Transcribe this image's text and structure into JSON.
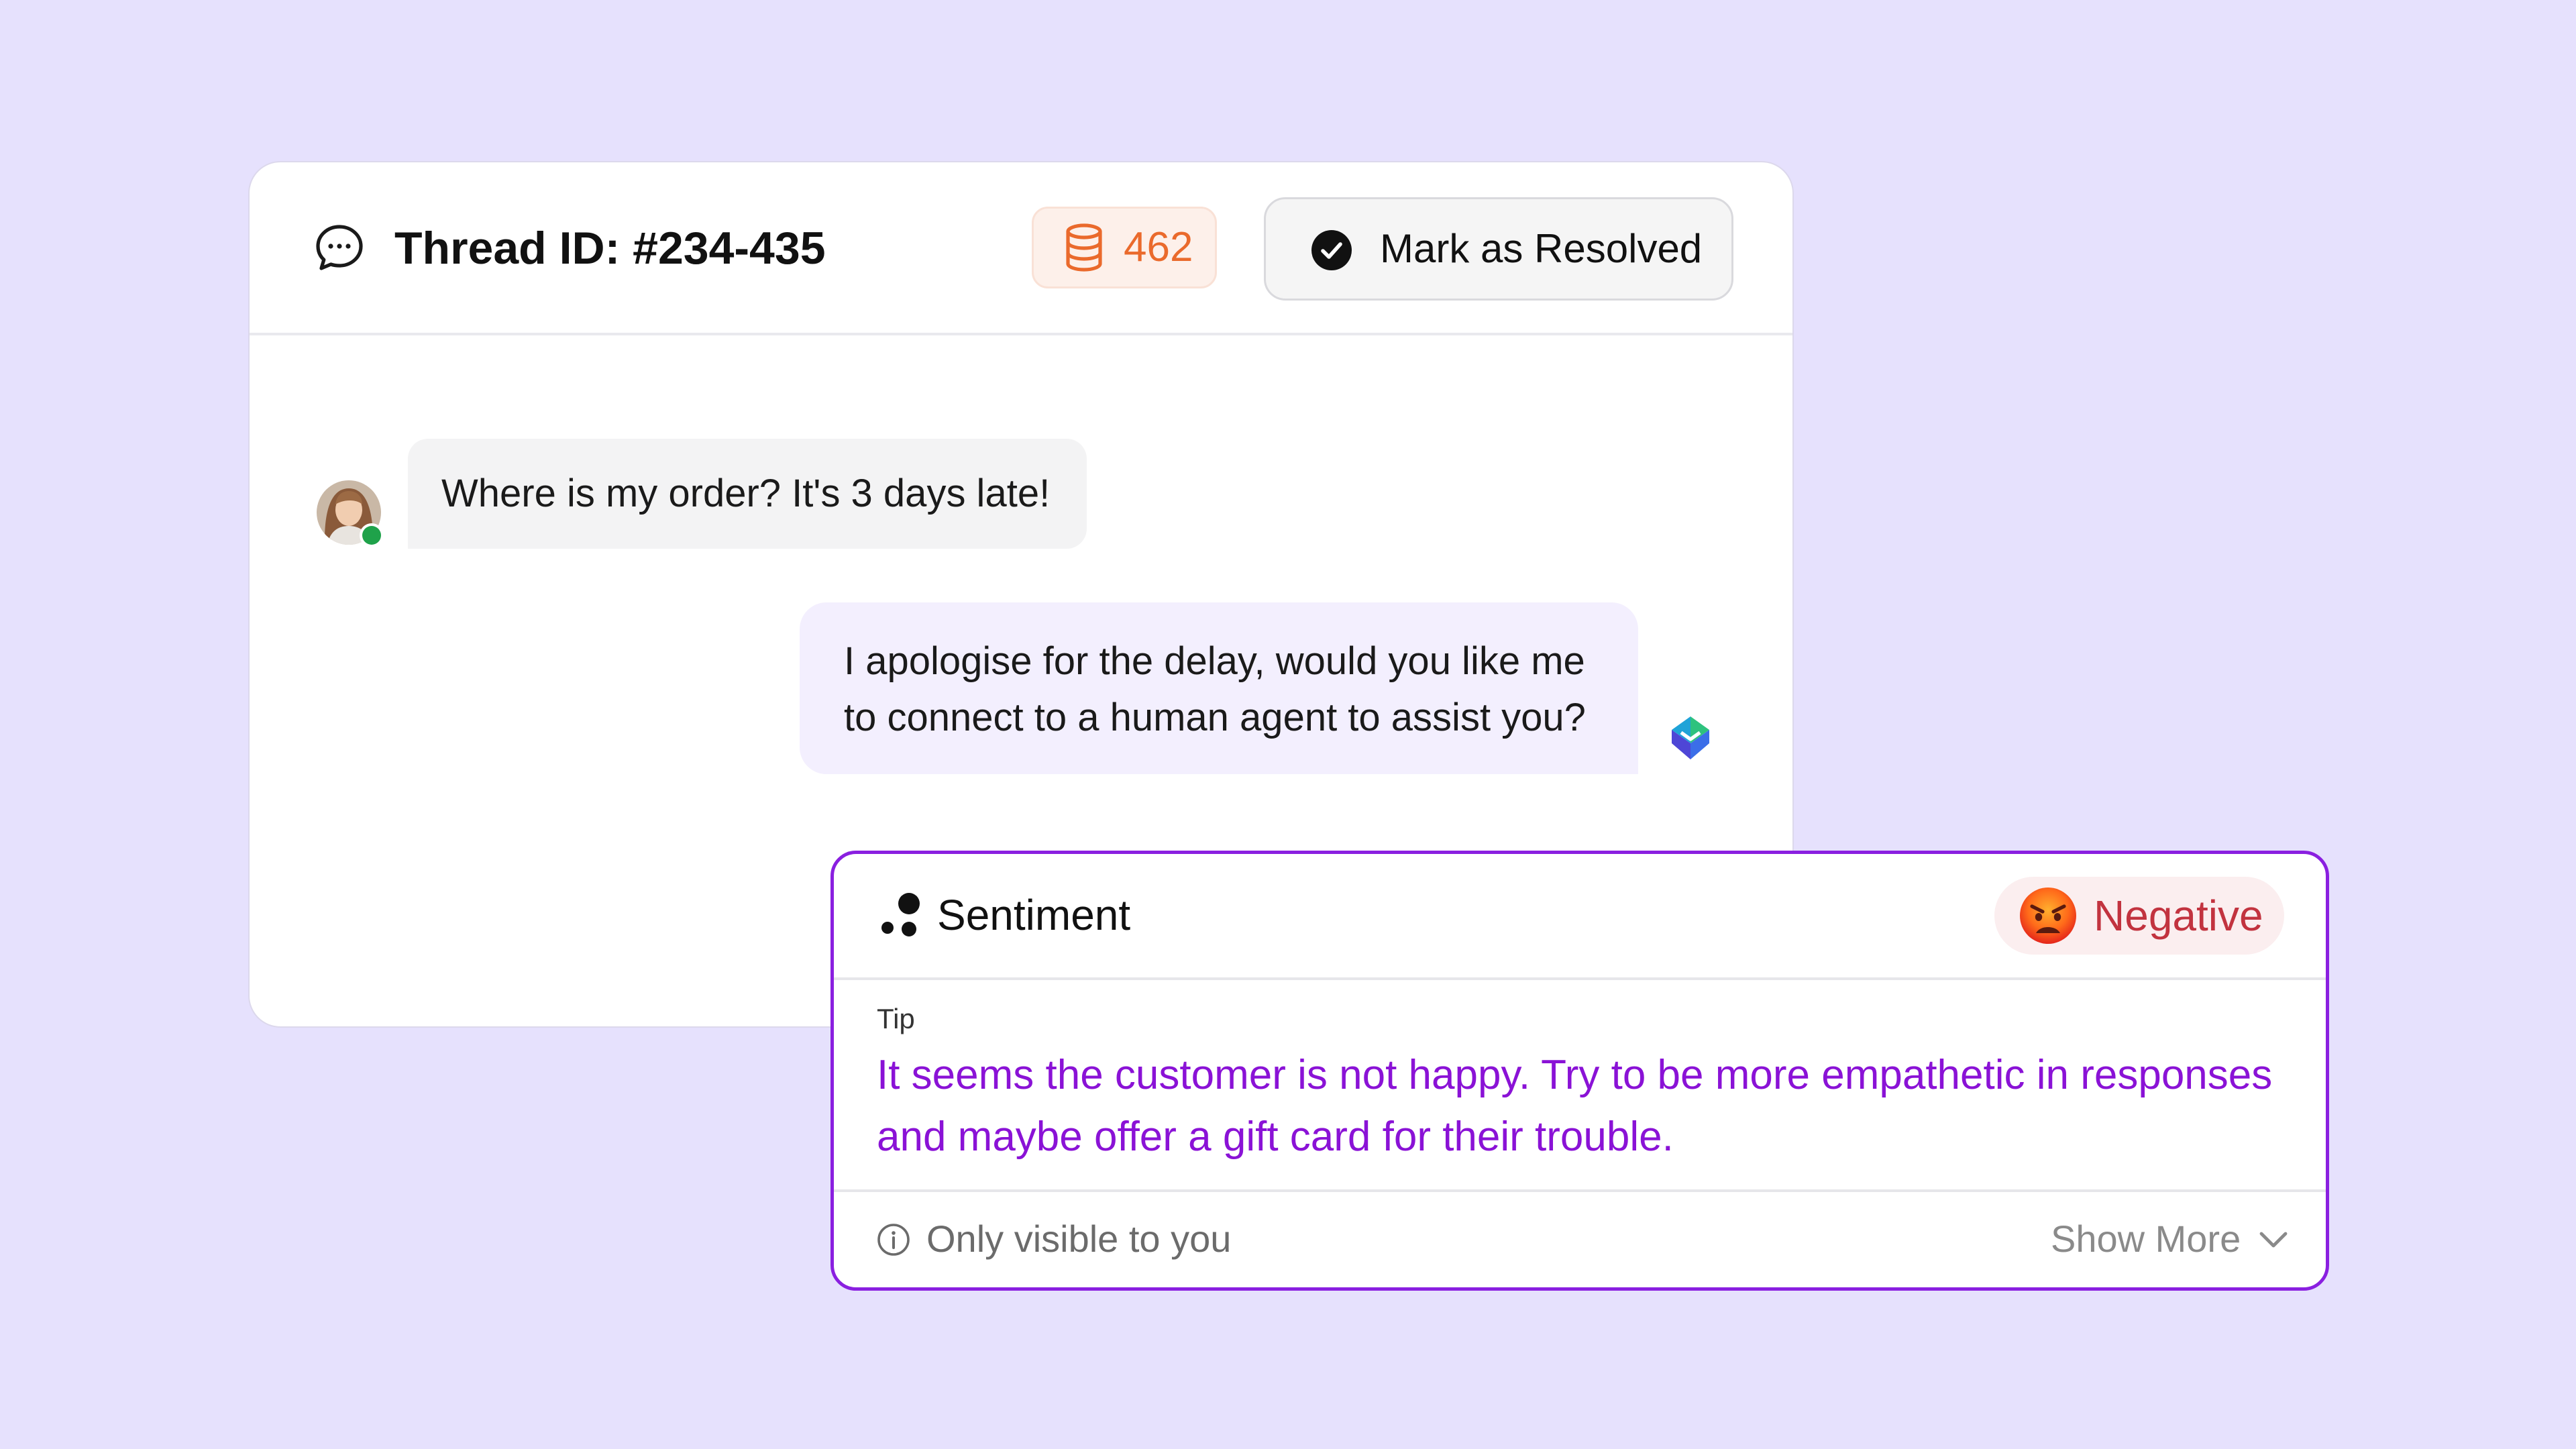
{
  "thread": {
    "title": "Thread ID: #234-435",
    "coins_count": "462",
    "resolve_label": "Mark as Resolved"
  },
  "messages": {
    "customer_text": "Where is my order? It's 3 days late!",
    "agent_text": "I apologise for the delay, would you like me to connect to a human agent to assist you?"
  },
  "sentiment": {
    "title": "Sentiment",
    "value": "Negative",
    "tip_label": "Tip",
    "tip_text": "It seems the customer is not happy. Try to be more empathetic in responses and maybe offer a gift card for their trouble.",
    "visibility_note": "Only visible to you",
    "show_more_label": "Show More"
  },
  "icons": {
    "thread": "chat-bubble-icon",
    "coins": "coins-stack-icon",
    "resolve": "check-circle-icon",
    "avatar": "customer-avatar",
    "bot": "bot-logo-icon",
    "sentiment": "dots-icon",
    "negative": "angry-face-icon",
    "info": "info-icon",
    "chevron": "chevron-down-icon"
  },
  "colors": {
    "background": "#e6e1fd",
    "accent_purple": "#8a1fe0",
    "tip_text": "#8a12d6",
    "coins_orange": "#ea6a2c",
    "negative_red": "#c2333f",
    "online_green": "#1fa24a"
  }
}
